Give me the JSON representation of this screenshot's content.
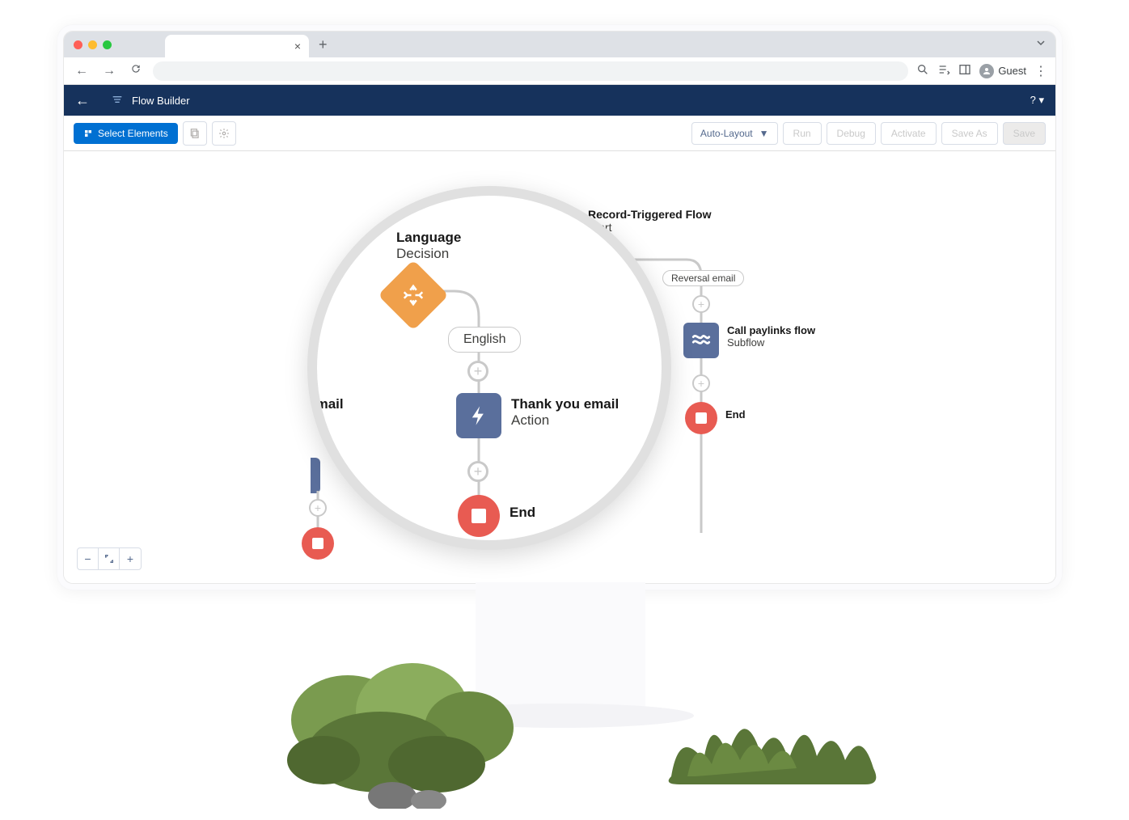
{
  "browser": {
    "guest_label": "Guest"
  },
  "app": {
    "title": "Flow Builder"
  },
  "toolbar": {
    "select_elements": "Select Elements",
    "layout_mode": "Auto-Layout",
    "run": "Run",
    "debug": "Debug",
    "activate": "Activate",
    "save_as": "Save As",
    "save": "Save"
  },
  "flow": {
    "trigger_title": "Record-Triggered Flow",
    "trigger_sub": "Start",
    "reversal_label": "Reversal email",
    "subflow_title": "Call paylinks flow",
    "subflow_sub": "Subflow",
    "end_label": "End",
    "left_peek": "k you email"
  },
  "magnifier": {
    "decision_title": "Language",
    "decision_sub": "Decision",
    "branch_label": "English",
    "action_title": "Thank you email",
    "action_sub": "Action",
    "end_label": "End"
  }
}
